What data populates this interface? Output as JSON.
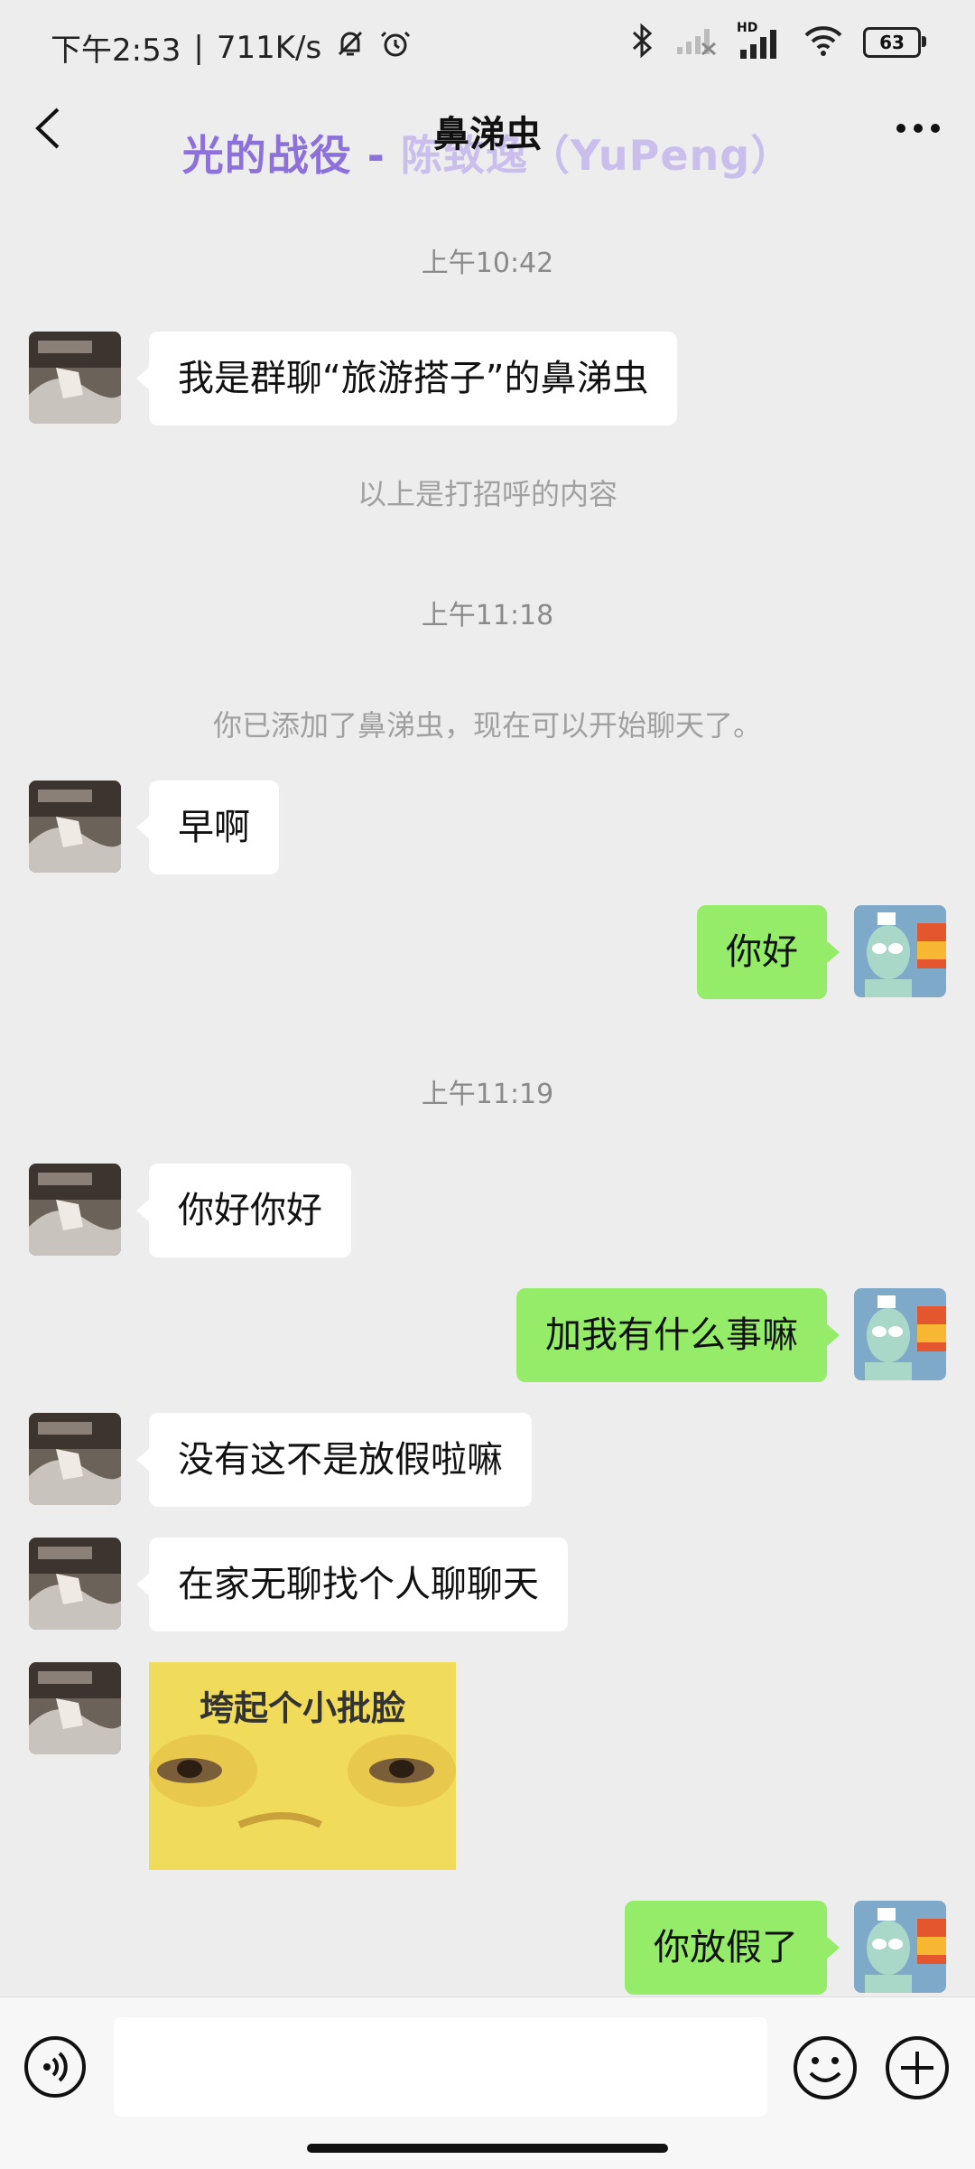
{
  "status_bar": {
    "time": "下午2:53",
    "network_speed": "711K/s",
    "battery": "63",
    "hd_label": "HD"
  },
  "header": {
    "title": "鼻涕虫",
    "watermark_main": "光的战役 - ",
    "watermark_faded": "陈致逸（YuPeng）"
  },
  "messages": {
    "ts1": "上午10:42",
    "m1": "我是群聊“旅游搭子”的鼻涕虫",
    "note1": "以上是打招呼的内容",
    "ts2": "上午11:18",
    "note2": "你已添加了鼻涕虫，现在可以开始聊天了。",
    "m2": "早啊",
    "m3": "你好",
    "ts3": "上午11:19",
    "m4": "你好你好",
    "m5": "加我有什么事嘛",
    "m6": "没有这不是放假啦嘛",
    "m7": "在家无聊找个人聊聊天",
    "sticker_text": "垮起个小批脸",
    "m8": "你放假了"
  },
  "input": {
    "value": ""
  },
  "colors": {
    "outgoing_bubble": "#95ec69",
    "incoming_bubble": "#ffffff",
    "background": "#ededed",
    "watermark": "#7b5cd6"
  }
}
